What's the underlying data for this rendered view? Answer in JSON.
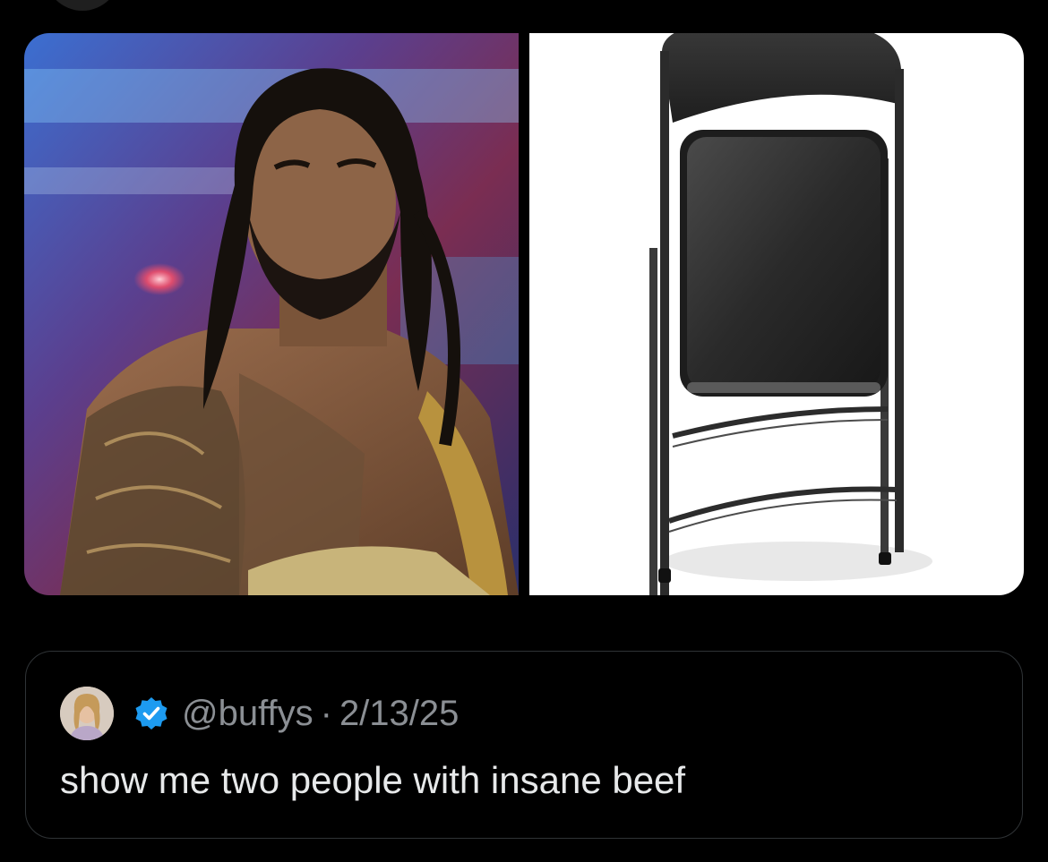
{
  "media": {
    "left_image": {
      "kind": "photo",
      "subject": "wrestler"
    },
    "right_image": {
      "kind": "photo",
      "subject": "folding-chair"
    }
  },
  "quoted_post": {
    "handle": "@buffys",
    "separator": "·",
    "date": "2/13/25",
    "text": "show me two people with insane beef"
  },
  "icons": {
    "verified": "verified-badge-icon"
  },
  "colors": {
    "background": "#000000",
    "border": "#2f3336",
    "muted_text": "#8b8f94",
    "primary_text": "#e7e9ea",
    "verified_blue": "#1d9bf0"
  }
}
